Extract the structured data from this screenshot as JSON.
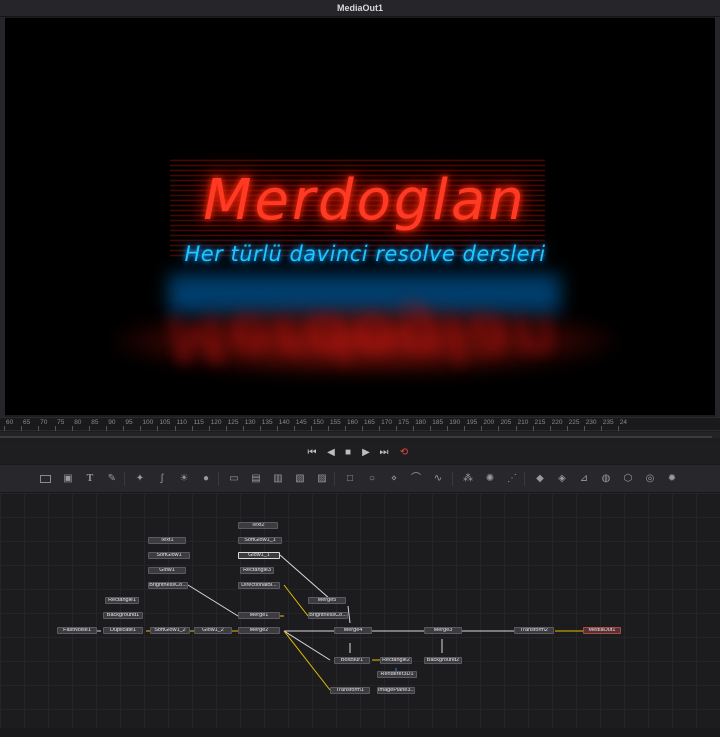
{
  "viewer": {
    "title": "MediaOut1",
    "main_text": "Merdoglan",
    "sub_text": "Her türlü davinci resolve dersleri"
  },
  "ruler": {
    "ticks": [
      "60",
      "65",
      "70",
      "75",
      "80",
      "85",
      "90",
      "95",
      "100",
      "105",
      "110",
      "115",
      "120",
      "125",
      "130",
      "135",
      "140",
      "145",
      "150",
      "155",
      "160",
      "165",
      "170",
      "175",
      "180",
      "185",
      "190",
      "195",
      "200",
      "205",
      "210",
      "215",
      "220",
      "225",
      "230",
      "235",
      "24"
    ]
  },
  "transport": {
    "first_icon": "skip-to-start-icon",
    "reverse_icon": "play-reverse-icon",
    "stop_icon": "stop-icon",
    "play_icon": "play-icon",
    "last_icon": "skip-to-end-icon",
    "loop_icon": "loop-icon",
    "loop_color": "#e8493d"
  },
  "nodes": {
    "Text1": "Text1",
    "SoftGlow1": "SoftGlow1",
    "Glow1": "Glow1",
    "BrightnessCo": "BrightnessCo...",
    "Text2": "Text2",
    "SoftGlow1_1": "SoftGlow1_1",
    "Glow1_1": "Glow1_1",
    "Rectangle3": "Rectangle3",
    "DirectionalB": "DirectionalBl...",
    "Merge5": "Merge5",
    "BrightnessCo2": "BrightnessCo...",
    "Rectangle1": "Rectangle1",
    "Background1": "Background1",
    "FastNoise1": "FastNoise1",
    "Duplicate1": "Duplicate1",
    "SoftGlow1_2": "SoftGlow1_2",
    "Glow1_2": "Glow1_2",
    "Merge1": "Merge1",
    "Merge2": "Merge2",
    "Merge4": "Merge4",
    "Merge3": "Merge3",
    "Transform2": "Transform2",
    "MediaOut1": "MediaOut1",
    "BoxBlur1": "BoxBlur1",
    "Rectangle2": "Rectangle2",
    "Renderer3D1": "Renderer3D1",
    "Background2": "Background2",
    "Transform1": "Transform1",
    "ImagePlane3D": "ImagePlane3..."
  },
  "colors": {
    "title_red": "#ff3a24",
    "subtitle_cyan": "#1ec8ff",
    "node_green": "#4caf50",
    "node_yellow": "#d4b800",
    "node_orange": "#d07a20",
    "node_blue": "#3a7ad0",
    "wire_white": "#d9d9d9",
    "wire_yellow": "#e0c000"
  }
}
